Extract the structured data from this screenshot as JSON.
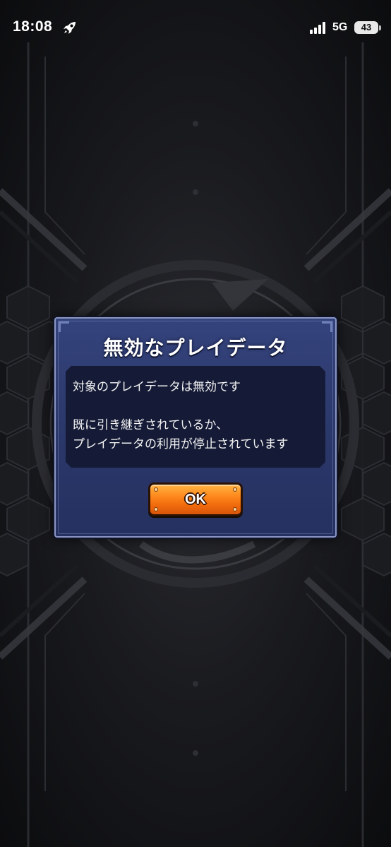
{
  "status_bar": {
    "time": "18:08",
    "network": "5G",
    "battery": "43",
    "icons": [
      "rocket-icon",
      "signal-icon",
      "battery-icon"
    ]
  },
  "dialog": {
    "title": "無効なプレイデータ",
    "message_lines": [
      "対象のプレイデータは無効です",
      "",
      "既に引き継ぎされているか、",
      "プレイデータの利用が停止されています"
    ],
    "ok_label": "OK"
  },
  "colors": {
    "dialog_bg": "#2a3769",
    "dialog_border": "#8b96c4",
    "message_bg": "#151b36",
    "button_orange": "#f06a0c"
  }
}
